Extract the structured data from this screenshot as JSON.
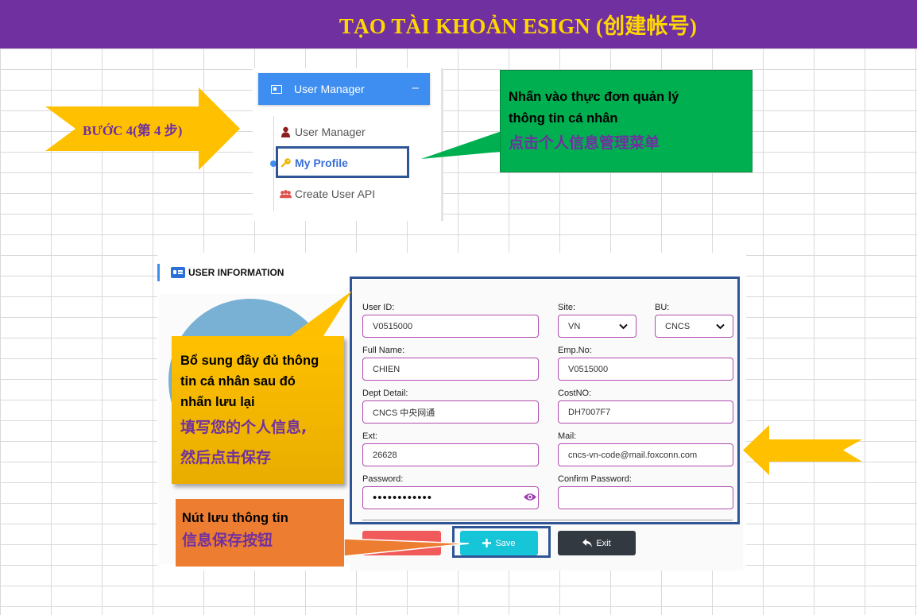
{
  "banner": {
    "title": "TẠO TÀI KHOẢN ESIGN (创建帐号)"
  },
  "step": {
    "label": "BƯỚC 4(第 4 步)"
  },
  "menu": {
    "header_label": "User Manager",
    "header_toggle": "–",
    "items": [
      {
        "label": "User Manager",
        "icon": "user-icon",
        "active": false
      },
      {
        "label": "My Profile",
        "icon": "key-icon",
        "active": true
      },
      {
        "label": "Create User API",
        "icon": "users-icon",
        "active": false
      }
    ]
  },
  "callouts": {
    "menu_vi_1": "Nhấn vào thực đơn quản lý",
    "menu_vi_2": "thông tin cá nhân",
    "menu_zh": "点击个人信息管理菜单",
    "form_vi_1": "Bổ sung đầy đủ thông",
    "form_vi_2": "tin cá nhân sau đó",
    "form_vi_3": "nhấn lưu lại",
    "form_zh_1": "填写您的个人信息,",
    "form_zh_2": "然后点击保存",
    "save_vi": "Nút lưu thông tin",
    "save_zh": "信息保存按钮"
  },
  "form": {
    "title": "USER INFORMATION",
    "fields": {
      "user_id": {
        "label": "User ID:",
        "value": "V0515000"
      },
      "site": {
        "label": "Site:",
        "value": "VN"
      },
      "bu": {
        "label": "BU:",
        "value": "CNCS"
      },
      "full_name": {
        "label": "Full Name:",
        "value": "CHIEN"
      },
      "emp_no": {
        "label": "Emp.No:",
        "value": "V0515000"
      },
      "dept_detail": {
        "label": "Dept Detail:",
        "value": "CNCS 中央网通"
      },
      "cost_no": {
        "label": "CostNO:",
        "value": "DH7007F7"
      },
      "ext": {
        "label": "Ext:",
        "value": "26628"
      },
      "mail": {
        "label": "Mail:",
        "value": "cncs-vn-code@mail.foxconn.com"
      },
      "password": {
        "label": "Password:",
        "value": "••••••••••••"
      },
      "confirm_password": {
        "label": "Confirm Password:",
        "value": ""
      }
    },
    "buttons": {
      "save": "Save",
      "exit": "Exit"
    }
  },
  "colors": {
    "banner_bg": "#7030a0",
    "banner_text": "#ffd700",
    "accent_blue": "#3d8ef0",
    "highlight_border": "#2f5597",
    "callout_green": "#00b050",
    "callout_yellow": "#ffc000",
    "callout_orange": "#ed7d31",
    "save_button": "#16c5d8",
    "exit_button": "#333940"
  }
}
